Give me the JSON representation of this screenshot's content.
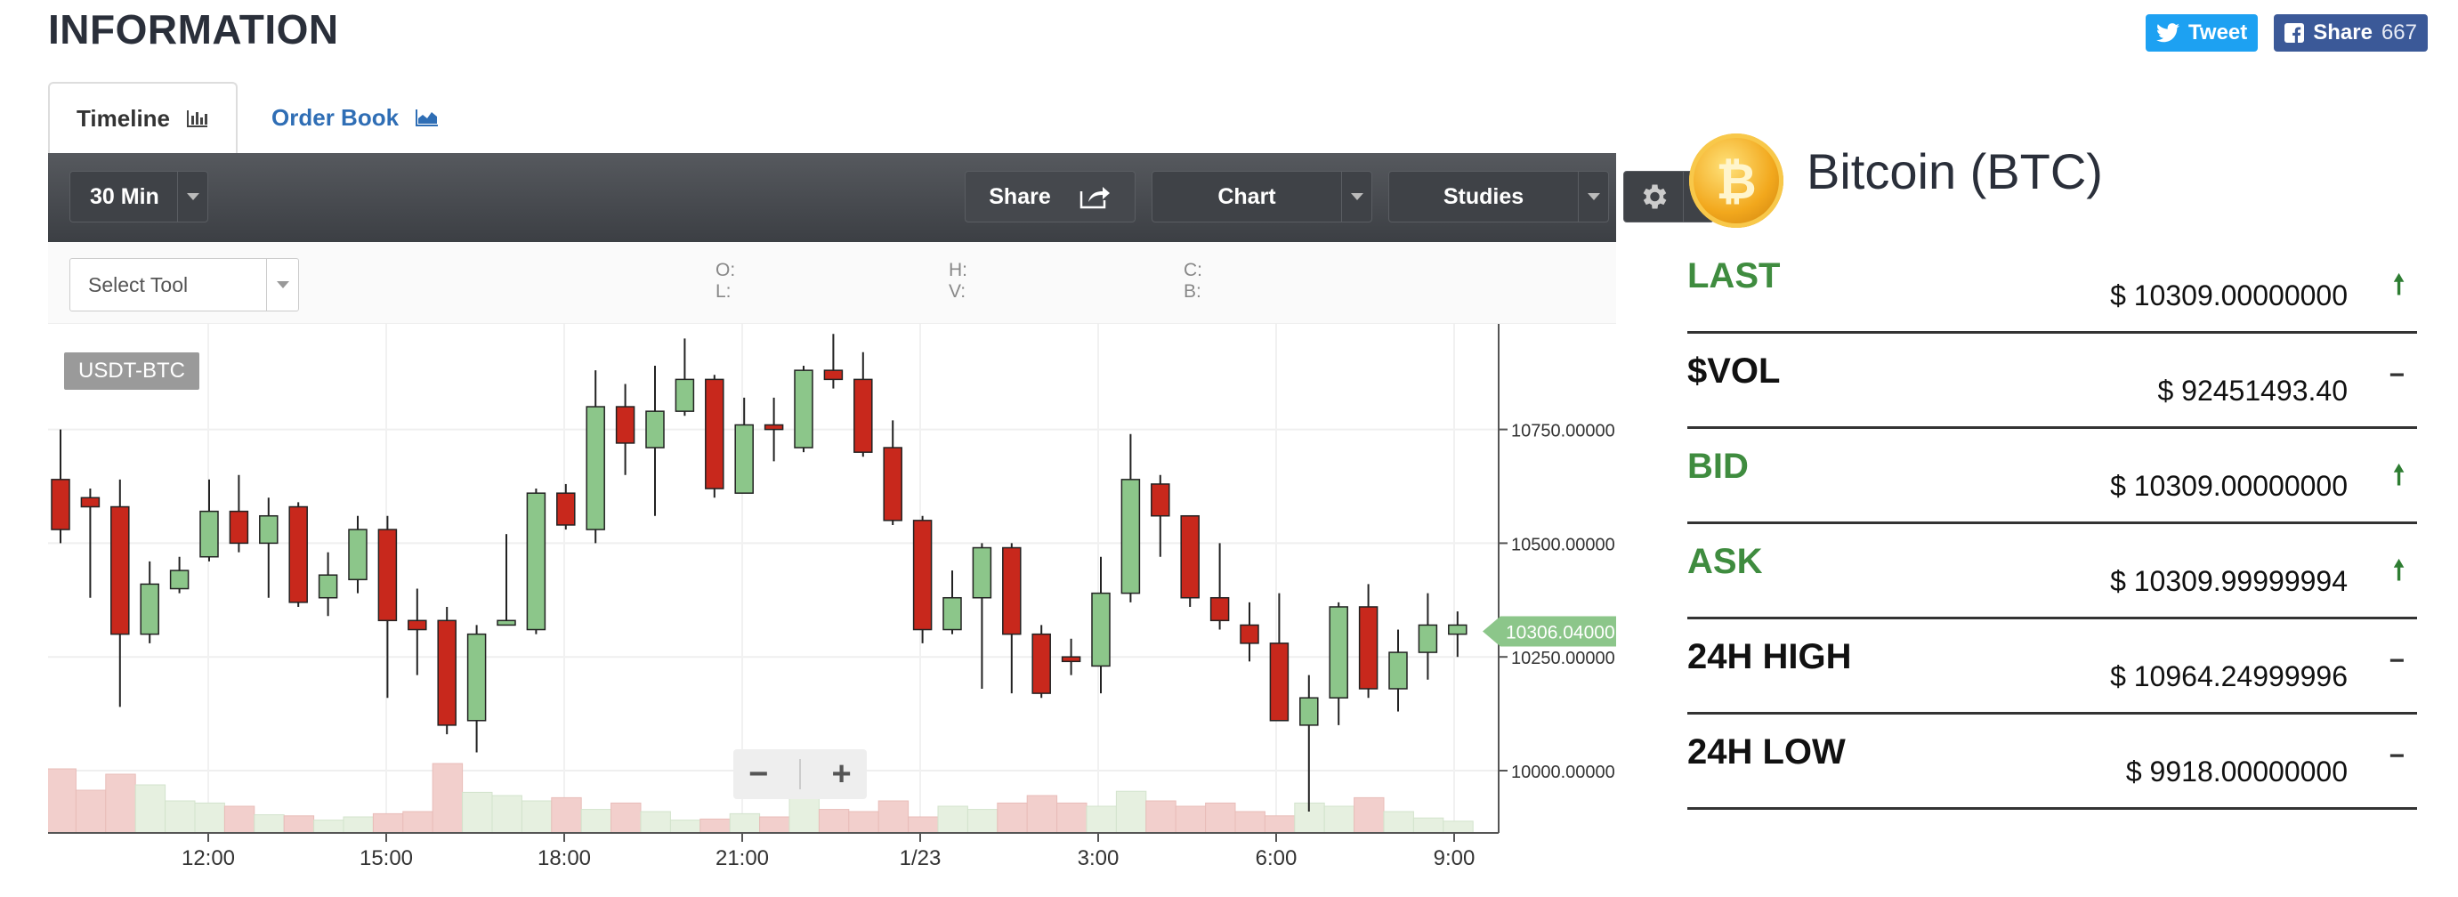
{
  "page": {
    "title": "INFORMATION"
  },
  "social": {
    "tweet_label": "Tweet",
    "share_label": "Share",
    "share_count": "667"
  },
  "tabs": [
    {
      "label": "Timeline",
      "icon": "bar-chart-icon"
    },
    {
      "label": "Order Book",
      "icon": "area-chart-icon"
    }
  ],
  "toolbar": {
    "interval": "30 Min",
    "share": "Share",
    "chart": "Chart",
    "studies": "Studies"
  },
  "subbar": {
    "select_tool": "Select Tool",
    "o": "O:",
    "l": "L:",
    "h": "H:",
    "v": "V:",
    "c": "C:",
    "b": "B:"
  },
  "chart_data": {
    "type": "candlestick",
    "pair_label": "USDT-BTC",
    "x_tick_labels": [
      "12:00",
      "15:00",
      "18:00",
      "21:00",
      "1/23",
      "3:00",
      "6:00",
      "9:00"
    ],
    "y_tick_labels": [
      "10750.00000",
      "10500.00000",
      "10250.00000",
      "10000.00000"
    ],
    "y_ticks": [
      10750,
      10500,
      10250,
      10000
    ],
    "current_price": "10306.04000",
    "current_value": 10306.04,
    "candles": [
      [
        10640,
        10530,
        10750,
        10500
      ],
      [
        10600,
        10580,
        10620,
        10380
      ],
      [
        10580,
        10300,
        10640,
        10140
      ],
      [
        10300,
        10410,
        10460,
        10280
      ],
      [
        10400,
        10440,
        10470,
        10390
      ],
      [
        10470,
        10570,
        10640,
        10460
      ],
      [
        10570,
        10500,
        10650,
        10480
      ],
      [
        10500,
        10560,
        10600,
        10380
      ],
      [
        10580,
        10370,
        10590,
        10360
      ],
      [
        10380,
        10430,
        10480,
        10340
      ],
      [
        10420,
        10530,
        10560,
        10390
      ],
      [
        10530,
        10330,
        10560,
        10160
      ],
      [
        10330,
        10310,
        10400,
        10210
      ],
      [
        10330,
        10100,
        10360,
        10080
      ],
      [
        10110,
        10300,
        10320,
        10040
      ],
      [
        10320,
        10330,
        10520,
        10330
      ],
      [
        10310,
        10610,
        10620,
        10300
      ],
      [
        10610,
        10540,
        10630,
        10530
      ],
      [
        10530,
        10800,
        10880,
        10500
      ],
      [
        10800,
        10720,
        10850,
        10650
      ],
      [
        10710,
        10790,
        10890,
        10560
      ],
      [
        10790,
        10860,
        10950,
        10780
      ],
      [
        10860,
        10620,
        10870,
        10600
      ],
      [
        10610,
        10760,
        10820,
        10610
      ],
      [
        10760,
        10750,
        10820,
        10680
      ],
      [
        10710,
        10880,
        10890,
        10700
      ],
      [
        10880,
        10860,
        10960,
        10840
      ],
      [
        10860,
        10700,
        10920,
        10690
      ],
      [
        10710,
        10550,
        10770,
        10540
      ],
      [
        10550,
        10310,
        10560,
        10280
      ],
      [
        10310,
        10380,
        10440,
        10300
      ],
      [
        10380,
        10490,
        10500,
        10180
      ],
      [
        10490,
        10300,
        10500,
        10170
      ],
      [
        10300,
        10170,
        10320,
        10160
      ],
      [
        10250,
        10240,
        10290,
        10210
      ],
      [
        10230,
        10390,
        10470,
        10170
      ],
      [
        10390,
        10640,
        10740,
        10370
      ],
      [
        10630,
        10560,
        10650,
        10470
      ],
      [
        10560,
        10380,
        10560,
        10360
      ],
      [
        10380,
        10330,
        10500,
        10310
      ],
      [
        10320,
        10280,
        10370,
        10240
      ],
      [
        10280,
        10110,
        10390,
        10110
      ],
      [
        10100,
        10160,
        10210,
        9910
      ],
      [
        10160,
        10360,
        10370,
        10100
      ],
      [
        10360,
        10180,
        10410,
        10160
      ],
      [
        10180,
        10260,
        10310,
        10130
      ],
      [
        10260,
        10320,
        10390,
        10200
      ],
      [
        10300,
        10320,
        10350,
        10250
      ]
    ],
    "volumes": [
      0.6,
      0.4,
      0.55,
      0.45,
      0.3,
      0.28,
      0.25,
      0.17,
      0.16,
      0.12,
      0.15,
      0.18,
      0.2,
      0.65,
      0.38,
      0.35,
      0.3,
      0.33,
      0.22,
      0.28,
      0.2,
      0.12,
      0.13,
      0.18,
      0.15,
      0.55,
      0.22,
      0.2,
      0.3,
      0.15,
      0.25,
      0.22,
      0.28,
      0.35,
      0.28,
      0.25,
      0.39,
      0.3,
      0.25,
      0.28,
      0.2,
      0.16,
      0.28,
      0.25,
      0.33,
      0.2,
      0.14,
      0.11
    ],
    "grid": true
  },
  "coin": {
    "name": "Bitcoin (BTC)",
    "icon": "bitcoin-logo-icon",
    "rows": [
      {
        "label": "LAST",
        "value": "$ 10309.00000000",
        "indicator": "up",
        "label_color": "#3f8c3f"
      },
      {
        "label": "$VOL",
        "value": "$ 92451493.40",
        "indicator": "flat",
        "label_color": "#111111"
      },
      {
        "label": "BID",
        "value": "$ 10309.00000000",
        "indicator": "up",
        "label_color": "#3f8c3f"
      },
      {
        "label": "ASK",
        "value": "$ 10309.99999994",
        "indicator": "up",
        "label_color": "#3f8c3f"
      },
      {
        "label": "24H HIGH",
        "value": "$ 10964.24999996",
        "indicator": "flat",
        "label_color": "#111111"
      },
      {
        "label": "24H LOW",
        "value": "$ 9918.00000000",
        "indicator": "flat",
        "label_color": "#111111"
      }
    ]
  },
  "colors": {
    "up": "#8cc68a",
    "down": "#c8281c",
    "volume_up": "#e6f0e0",
    "volume_down": "#f2cfcc",
    "accent_link": "#2f6eb5"
  }
}
